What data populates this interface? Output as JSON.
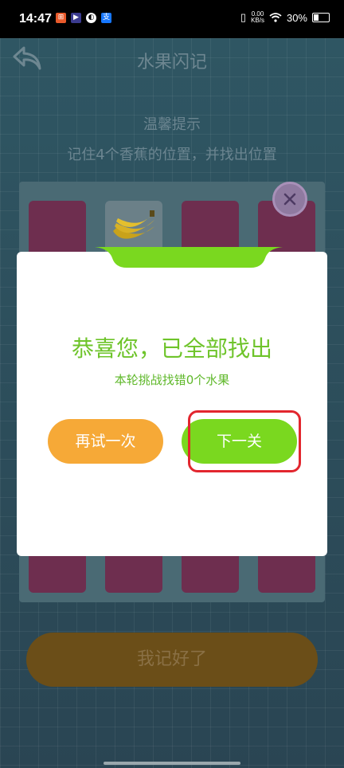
{
  "status_bar": {
    "time": "14:47",
    "net_speed_value": "0.00",
    "net_speed_unit": "KB/s",
    "battery": "30%",
    "icons": [
      "notification-app-icon",
      "media-app-icon",
      "browser-app-icon",
      "alipay-icon"
    ]
  },
  "header": {
    "title": "水果闪记"
  },
  "tips": {
    "title": "温馨提示",
    "text": "记住4个香蕉的位置，并找出位置"
  },
  "board": {
    "revealed_fruit": "banana"
  },
  "footer": {
    "remember_button": "我记好了"
  },
  "dialog": {
    "headline": "恭喜您，已全部找出",
    "summary": "本轮挑战找错0个水果",
    "retry_button": "再试一次",
    "next_button": "下一关"
  },
  "colors": {
    "accent_green": "#7ad81f",
    "retry_orange": "#f6a937",
    "highlight_red": "#e2262e",
    "card_pink": "#6e2e4f"
  }
}
